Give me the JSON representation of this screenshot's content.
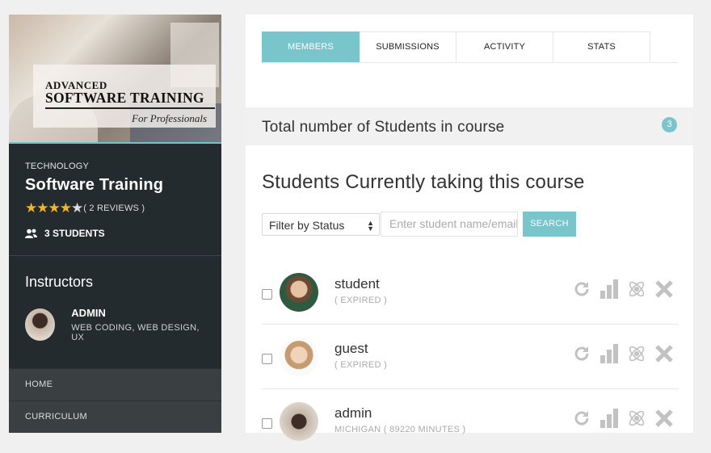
{
  "sidebar": {
    "cover": {
      "line1": "ADVANCED",
      "line2": "SOFTWARE TRAINING",
      "line3": "For Professionals"
    },
    "category": "TECHNOLOGY",
    "course_title": "Software Training",
    "rating": 4.5,
    "reviews_label": "( 2 REVIEWS )",
    "students_label": "3 STUDENTS",
    "instructors_heading": "Instructors",
    "instructor": {
      "name": "ADMIN",
      "skills": "WEB CODING, WEB DESIGN, UX",
      "avatar_icon": "instructor-avatar"
    },
    "nav": [
      {
        "label": "HOME"
      },
      {
        "label": "CURRICULUM"
      }
    ]
  },
  "main": {
    "tabs": [
      {
        "label": "MEMBERS",
        "active": true
      },
      {
        "label": "SUBMISSIONS",
        "active": false
      },
      {
        "label": "ACTIVITY",
        "active": false
      },
      {
        "label": "STATS",
        "active": false
      }
    ],
    "total_label": "Total number of Students in course",
    "total_count": "3",
    "section_title": "Students Currently taking this course",
    "filter": {
      "selected": "Filter by Status"
    },
    "search": {
      "placeholder": "Enter student name/email",
      "button_label": "SEARCH"
    },
    "students": [
      {
        "name": "student",
        "meta": "( EXPIRED )"
      },
      {
        "name": "guest",
        "meta": "( EXPIRED )"
      },
      {
        "name": "admin",
        "meta": "MICHIGAN ( 89220 MINUTES )"
      }
    ],
    "row_actions": [
      "refresh-icon",
      "stats-bar-icon",
      "atom-icon",
      "remove-x-icon"
    ]
  },
  "colors": {
    "accent": "#78c5cc",
    "sidebar_bg": "#232b2f",
    "star": "#f3b51b",
    "icon_gray": "#c2c2c2"
  }
}
